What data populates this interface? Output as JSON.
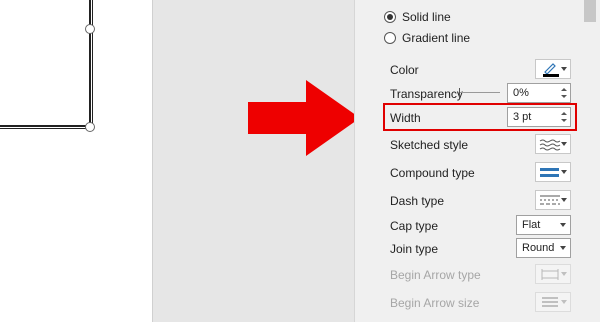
{
  "line_options": {
    "solid_line": {
      "label": "Solid line",
      "selected": true
    },
    "gradient_line": {
      "label": "Gradient line",
      "selected": false
    }
  },
  "properties": {
    "color": {
      "label": "Color",
      "icon": "pen-color-icon"
    },
    "transparency": {
      "label": "Transparency",
      "value": "0%"
    },
    "width": {
      "label": "Width",
      "value": "3 pt"
    },
    "sketched_style": {
      "label": "Sketched style",
      "icon": "sketched-line-icon"
    },
    "compound_type": {
      "label": "Compound type",
      "icon": "compound-line-icon"
    },
    "dash_type": {
      "label": "Dash type",
      "icon": "dash-line-icon"
    },
    "cap_type": {
      "label": "Cap type",
      "value": "Flat"
    },
    "join_type": {
      "label": "Join type",
      "value": "Round"
    },
    "begin_arrow_type": {
      "label": "Begin Arrow type",
      "icon": "arrow-type-icon",
      "disabled": true
    },
    "begin_arrow_size": {
      "label": "Begin Arrow size",
      "icon": "arrow-size-icon",
      "disabled": true
    }
  },
  "colors": {
    "highlight": "#e00000",
    "arrow": "#ee0000",
    "accent_blue": "#2e75b6"
  }
}
